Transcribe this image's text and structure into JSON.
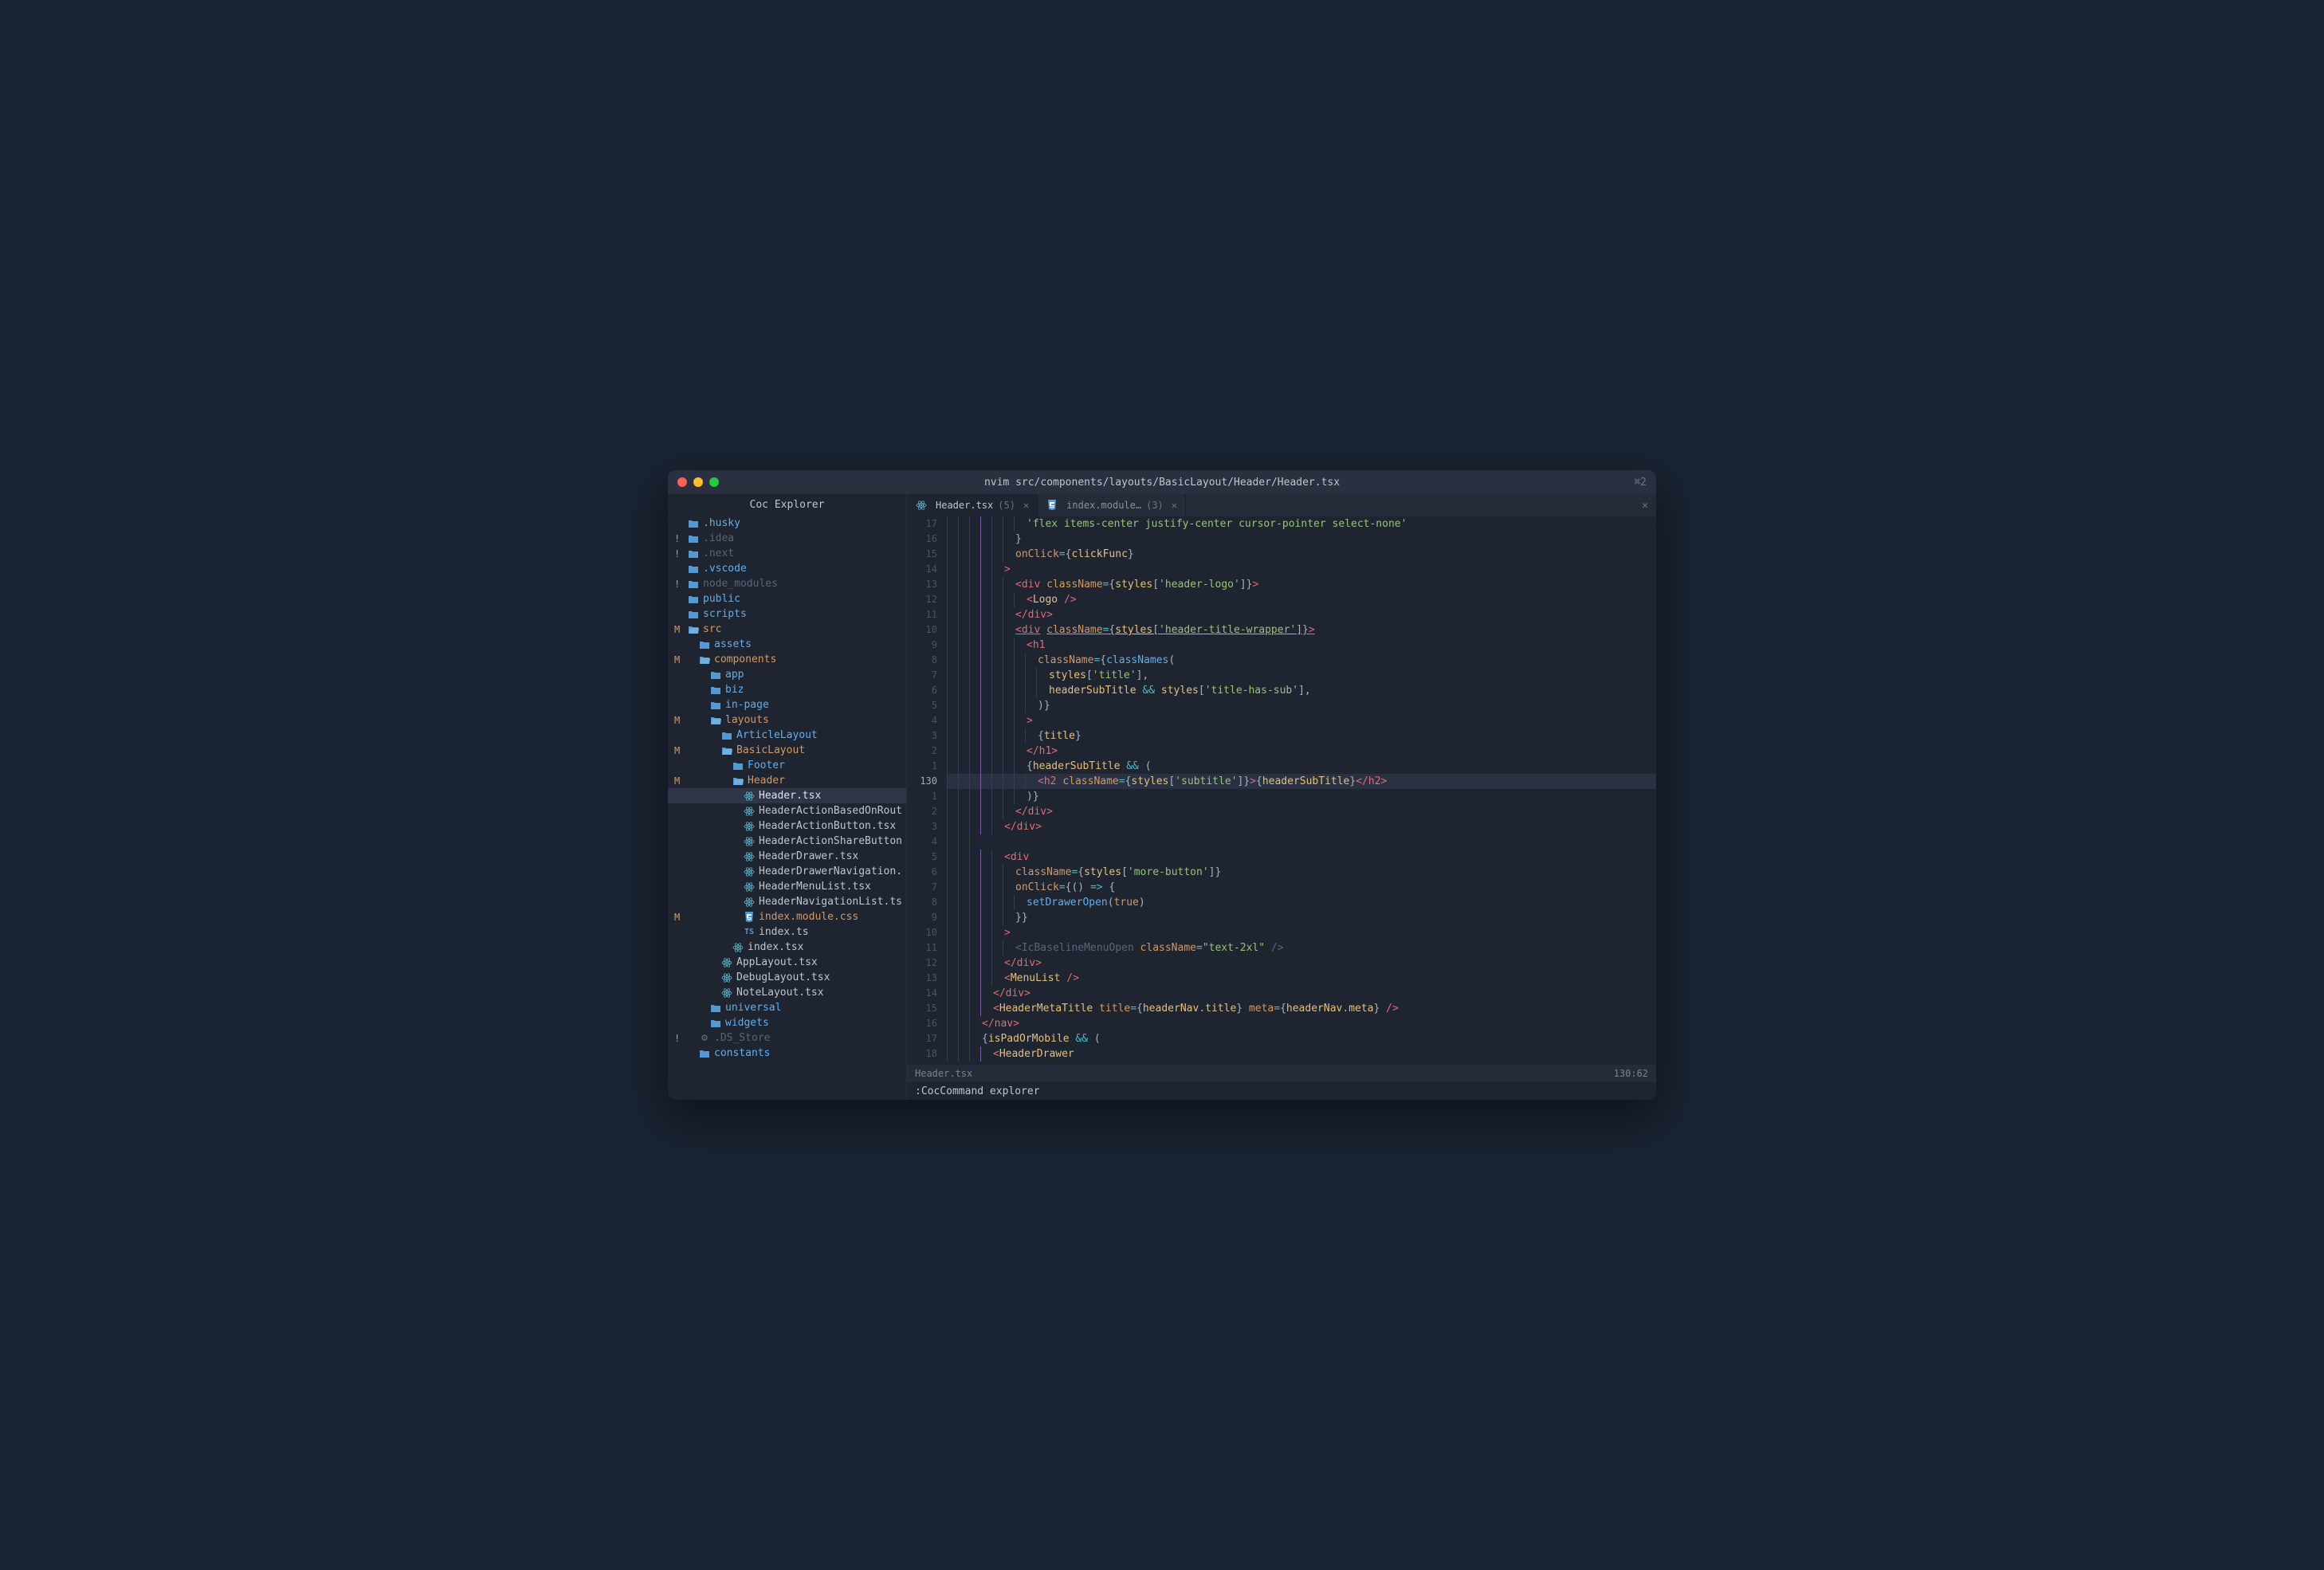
{
  "window": {
    "title": "nvim src/components/layouts/BasicLayout/Header/Header.tsx",
    "right_indicator": "⌘2"
  },
  "sidebar": {
    "title": "Coc Explorer",
    "tree": [
      {
        "status": "",
        "indent": 0,
        "icon": "folder",
        "name": ".husky",
        "cls": "blue"
      },
      {
        "status": "!",
        "indent": 0,
        "icon": "folder",
        "name": ".idea",
        "cls": "dim"
      },
      {
        "status": "!",
        "indent": 0,
        "icon": "folder",
        "name": ".next",
        "cls": "dim"
      },
      {
        "status": "",
        "indent": 0,
        "icon": "folder",
        "name": ".vscode",
        "cls": "blue"
      },
      {
        "status": "!",
        "indent": 0,
        "icon": "folder",
        "name": "node_modules",
        "cls": "dim"
      },
      {
        "status": "",
        "indent": 0,
        "icon": "folder",
        "name": "public",
        "cls": "blue"
      },
      {
        "status": "",
        "indent": 0,
        "icon": "folder",
        "name": "scripts",
        "cls": "blue"
      },
      {
        "status": "M",
        "indent": 0,
        "icon": "folder-open",
        "name": "src",
        "cls": "orange"
      },
      {
        "status": "",
        "indent": 1,
        "icon": "folder",
        "name": "assets",
        "cls": "blue"
      },
      {
        "status": "M",
        "indent": 1,
        "icon": "folder-open",
        "name": "components",
        "cls": "orange"
      },
      {
        "status": "",
        "indent": 2,
        "icon": "folder",
        "name": "app",
        "cls": "blue"
      },
      {
        "status": "",
        "indent": 2,
        "icon": "folder",
        "name": "biz",
        "cls": "blue"
      },
      {
        "status": "",
        "indent": 2,
        "icon": "folder",
        "name": "in-page",
        "cls": "blue"
      },
      {
        "status": "M",
        "indent": 2,
        "icon": "folder-open",
        "name": "layouts",
        "cls": "orange"
      },
      {
        "status": "",
        "indent": 3,
        "icon": "folder",
        "name": "ArticleLayout",
        "cls": "blue"
      },
      {
        "status": "M",
        "indent": 3,
        "icon": "folder-open",
        "name": "BasicLayout",
        "cls": "orange"
      },
      {
        "status": "",
        "indent": 4,
        "icon": "folder",
        "name": "Footer",
        "cls": "blue"
      },
      {
        "status": "M",
        "indent": 4,
        "icon": "folder-open",
        "name": "Header",
        "cls": "orange"
      },
      {
        "status": "",
        "indent": 5,
        "icon": "react",
        "name": "Header.tsx",
        "cls": "bold",
        "selected": true
      },
      {
        "status": "",
        "indent": 5,
        "icon": "react",
        "name": "HeaderActionBasedOnRout",
        "cls": ""
      },
      {
        "status": "",
        "indent": 5,
        "icon": "react",
        "name": "HeaderActionButton.tsx",
        "cls": ""
      },
      {
        "status": "",
        "indent": 5,
        "icon": "react",
        "name": "HeaderActionShareButton",
        "cls": ""
      },
      {
        "status": "",
        "indent": 5,
        "icon": "react",
        "name": "HeaderDrawer.tsx",
        "cls": ""
      },
      {
        "status": "",
        "indent": 5,
        "icon": "react",
        "name": "HeaderDrawerNavigation.",
        "cls": ""
      },
      {
        "status": "",
        "indent": 5,
        "icon": "react",
        "name": "HeaderMenuList.tsx",
        "cls": ""
      },
      {
        "status": "",
        "indent": 5,
        "icon": "react",
        "name": "HeaderNavigationList.ts",
        "cls": ""
      },
      {
        "status": "M",
        "indent": 5,
        "icon": "css",
        "name": "index.module.css",
        "cls": "orange"
      },
      {
        "status": "",
        "indent": 5,
        "icon": "ts",
        "name": "index.ts",
        "cls": ""
      },
      {
        "status": "",
        "indent": 4,
        "icon": "react",
        "name": "index.tsx",
        "cls": ""
      },
      {
        "status": "",
        "indent": 3,
        "icon": "react",
        "name": "AppLayout.tsx",
        "cls": ""
      },
      {
        "status": "",
        "indent": 3,
        "icon": "react",
        "name": "DebugLayout.tsx",
        "cls": ""
      },
      {
        "status": "",
        "indent": 3,
        "icon": "react",
        "name": "NoteLayout.tsx",
        "cls": ""
      },
      {
        "status": "",
        "indent": 2,
        "icon": "folder",
        "name": "universal",
        "cls": "blue"
      },
      {
        "status": "",
        "indent": 2,
        "icon": "folder",
        "name": "widgets",
        "cls": "blue"
      },
      {
        "status": "!",
        "indent": 1,
        "icon": "gear",
        "name": ".DS_Store",
        "cls": "dim"
      },
      {
        "status": "",
        "indent": 1,
        "icon": "folder",
        "name": "constants",
        "cls": "blue"
      }
    ]
  },
  "tabs": [
    {
      "icon": "react",
      "label": "Header.tsx",
      "count": "(5)",
      "active": true
    },
    {
      "icon": "css",
      "label": "index.module…",
      "count": "(3)",
      "active": false
    }
  ],
  "gutter": [
    "17",
    "16",
    "15",
    "14",
    "13",
    "12",
    "11",
    "10",
    "9",
    "8",
    "7",
    "6",
    "5",
    "4",
    "3",
    "2",
    "1",
    "130",
    "1",
    "2",
    "3",
    "4",
    "5",
    "6",
    "7",
    "8",
    "9",
    "10",
    "11",
    "12",
    "13",
    "14",
    "15",
    "16",
    "17",
    "18"
  ],
  "gutter_current_index": 17,
  "code_lines": [
    {
      "g": 4,
      "html": "<span class='str'>'flex items-center justify-center cursor-pointer select-none'</span>"
    },
    {
      "g": 3,
      "html": "<span class='punct'>}</span>"
    },
    {
      "g": 3,
      "html": "<span class='attr'>onClick</span><span class='op'>=</span><span class='punct'>{</span><span class='var'>clickFunc</span><span class='punct'>}</span>"
    },
    {
      "g": 2,
      "html": "<span class='tag'>&gt;</span>"
    },
    {
      "g": 3,
      "html": "<span class='tag'>&lt;div</span> <span class='attr'>className</span><span class='op'>=</span><span class='punct'>{</span><span class='var'>styles</span><span class='punct'>[</span><span class='str'>'header-logo'</span><span class='punct'>]}</span><span class='tag'>&gt;</span>"
    },
    {
      "g": 4,
      "html": "<span class='tag'>&lt;</span><span class='var'>Logo</span> <span class='tag'>/&gt;</span>"
    },
    {
      "g": 3,
      "html": "<span class='tag'>&lt;/div&gt;</span>"
    },
    {
      "g": 3,
      "html": "<span class='tag underline'>&lt;div</span> <span class='attr underline'>className</span><span class='op underline'>=</span><span class='punct underline'>{</span><span class='var underline'>styles</span><span class='punct underline'>[</span><span class='str underline'>'header-title-wrapper'</span><span class='punct underline'>]}</span><span class='tag underline'>&gt;</span>"
    },
    {
      "g": 4,
      "html": "<span class='tag'>&lt;h1</span>"
    },
    {
      "g": 5,
      "html": "<span class='attr'>className</span><span class='op'>=</span><span class='punct'>{</span><span class='fn'>classNames</span><span class='punct'>(</span>"
    },
    {
      "g": 6,
      "html": "<span class='var'>styles</span><span class='punct'>[</span><span class='str'>'title'</span><span class='punct'>],</span>"
    },
    {
      "g": 6,
      "html": "<span class='var'>headerSubTitle</span> <span class='op'>&amp;&amp;</span> <span class='var'>styles</span><span class='punct'>[</span><span class='str'>'title-has-sub'</span><span class='punct'>],</span>"
    },
    {
      "g": 5,
      "html": "<span class='punct'>)}</span>"
    },
    {
      "g": 4,
      "html": "<span class='tag'>&gt;</span>"
    },
    {
      "g": 5,
      "html": "<span class='punct'>{</span><span class='var'>title</span><span class='punct'>}</span>"
    },
    {
      "g": 4,
      "html": "<span class='tag'>&lt;/h1&gt;</span>"
    },
    {
      "g": 4,
      "html": "<span class='punct'>{</span><span class='var'>headerSubTitle</span> <span class='op'>&amp;&amp;</span> <span class='punct'>(</span>"
    },
    {
      "g": 5,
      "html": "<span class='tag'>&lt;h2</span> <span class='attr'>className</span><span class='op'>=</span><span class='punct'>{</span><span class='var'>styles</span><span class='punct'>[</span><span class='str'>'subtitle'</span><span class='punct'>]}</span><span class='tag'>&gt;</span><span class='punct'>{</span><span class='var'>headerSubTitle</span><span class='punct'>}</span><span class='tag'>&lt;/h2&gt;</span>",
      "hl": true
    },
    {
      "g": 4,
      "html": "<span class='punct'>)}</span>"
    },
    {
      "g": 3,
      "html": "<span class='tag'>&lt;/div&gt;</span>"
    },
    {
      "g": 2,
      "html": "<span class='tag'>&lt;/div&gt;</span>"
    },
    {
      "g": 0,
      "html": ""
    },
    {
      "g": 2,
      "html": "<span class='tag'>&lt;div</span>"
    },
    {
      "g": 3,
      "html": "<span class='attr'>className</span><span class='op'>=</span><span class='punct'>{</span><span class='var'>styles</span><span class='punct'>[</span><span class='str'>'more-button'</span><span class='punct'>]}</span>"
    },
    {
      "g": 3,
      "html": "<span class='attr'>onClick</span><span class='op'>=</span><span class='punct'>{() </span><span class='op'>=&gt;</span><span class='punct'> {</span>"
    },
    {
      "g": 4,
      "html": "<span class='fn'>setDrawerOpen</span><span class='punct'>(</span><span class='num'>true</span><span class='punct'>)</span>"
    },
    {
      "g": 3,
      "html": "<span class='punct'>}}</span>"
    },
    {
      "g": 2,
      "html": "<span class='tag'>&gt;</span>"
    },
    {
      "g": 3,
      "html": "<span class='dim'>&lt;IcBaselineMenuOpen </span><span class='attr'>className</span><span class='op'>=</span><span class='str'>\"text-2xl\"</span><span class='dim'> /&gt;</span>"
    },
    {
      "g": 2,
      "html": "<span class='tag'>&lt;/div&gt;</span>"
    },
    {
      "g": 2,
      "html": "<span class='tag'>&lt;</span><span class='var'>MenuList</span> <span class='tag'>/&gt;</span>"
    },
    {
      "g": 1,
      "html": "<span class='tag'>&lt;/div&gt;</span>"
    },
    {
      "g": 1,
      "html": "<span class='tag'>&lt;</span><span class='var'>HeaderMetaTitle</span> <span class='attr'>title</span><span class='op'>=</span><span class='punct'>{</span><span class='var'>headerNav</span><span class='punct'>.</span><span class='var'>title</span><span class='punct'>}</span> <span class='attr'>meta</span><span class='op'>=</span><span class='punct'>{</span><span class='var'>headerNav</span><span class='punct'>.</span><span class='var'>meta</span><span class='punct'>}</span> <span class='tag'>/&gt;</span>"
    },
    {
      "g": 0,
      "html": "<span class='tag'>&lt;/nav&gt;</span>"
    },
    {
      "g": 0,
      "html": "<span class='punct'>{</span><span class='var'>isPadOrMobile</span> <span class='op'>&amp;&amp;</span> <span class='punct'>(</span>"
    },
    {
      "g": 1,
      "html": "<span class='tag'>&lt;</span><span class='var'>HeaderDrawer</span>"
    }
  ],
  "statusbar": {
    "file": "Header.tsx",
    "pos": "130:62"
  },
  "cmdline": ":CocCommand explorer"
}
